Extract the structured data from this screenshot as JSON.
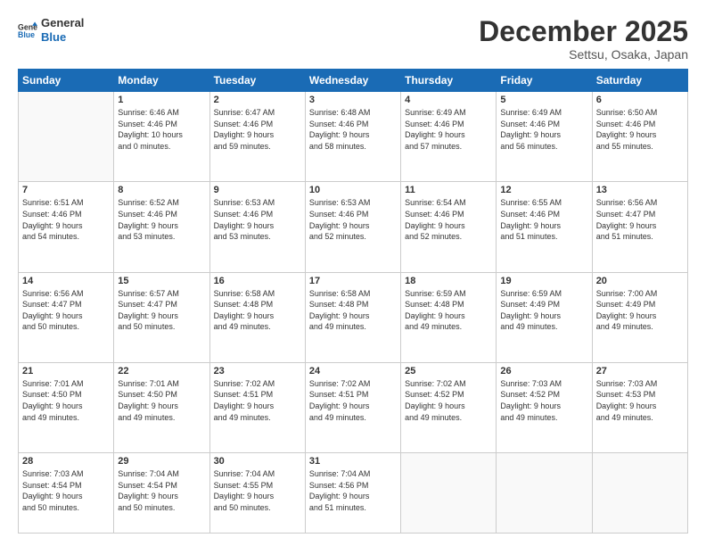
{
  "logo": {
    "line1": "General",
    "line2": "Blue"
  },
  "title": "December 2025",
  "location": "Settsu, Osaka, Japan",
  "days_of_week": [
    "Sunday",
    "Monday",
    "Tuesday",
    "Wednesday",
    "Thursday",
    "Friday",
    "Saturday"
  ],
  "weeks": [
    [
      {
        "day": "",
        "info": ""
      },
      {
        "day": "1",
        "info": "Sunrise: 6:46 AM\nSunset: 4:46 PM\nDaylight: 10 hours\nand 0 minutes."
      },
      {
        "day": "2",
        "info": "Sunrise: 6:47 AM\nSunset: 4:46 PM\nDaylight: 9 hours\nand 59 minutes."
      },
      {
        "day": "3",
        "info": "Sunrise: 6:48 AM\nSunset: 4:46 PM\nDaylight: 9 hours\nand 58 minutes."
      },
      {
        "day": "4",
        "info": "Sunrise: 6:49 AM\nSunset: 4:46 PM\nDaylight: 9 hours\nand 57 minutes."
      },
      {
        "day": "5",
        "info": "Sunrise: 6:49 AM\nSunset: 4:46 PM\nDaylight: 9 hours\nand 56 minutes."
      },
      {
        "day": "6",
        "info": "Sunrise: 6:50 AM\nSunset: 4:46 PM\nDaylight: 9 hours\nand 55 minutes."
      }
    ],
    [
      {
        "day": "7",
        "info": "Sunrise: 6:51 AM\nSunset: 4:46 PM\nDaylight: 9 hours\nand 54 minutes."
      },
      {
        "day": "8",
        "info": "Sunrise: 6:52 AM\nSunset: 4:46 PM\nDaylight: 9 hours\nand 53 minutes."
      },
      {
        "day": "9",
        "info": "Sunrise: 6:53 AM\nSunset: 4:46 PM\nDaylight: 9 hours\nand 53 minutes."
      },
      {
        "day": "10",
        "info": "Sunrise: 6:53 AM\nSunset: 4:46 PM\nDaylight: 9 hours\nand 52 minutes."
      },
      {
        "day": "11",
        "info": "Sunrise: 6:54 AM\nSunset: 4:46 PM\nDaylight: 9 hours\nand 52 minutes."
      },
      {
        "day": "12",
        "info": "Sunrise: 6:55 AM\nSunset: 4:46 PM\nDaylight: 9 hours\nand 51 minutes."
      },
      {
        "day": "13",
        "info": "Sunrise: 6:56 AM\nSunset: 4:47 PM\nDaylight: 9 hours\nand 51 minutes."
      }
    ],
    [
      {
        "day": "14",
        "info": "Sunrise: 6:56 AM\nSunset: 4:47 PM\nDaylight: 9 hours\nand 50 minutes."
      },
      {
        "day": "15",
        "info": "Sunrise: 6:57 AM\nSunset: 4:47 PM\nDaylight: 9 hours\nand 50 minutes."
      },
      {
        "day": "16",
        "info": "Sunrise: 6:58 AM\nSunset: 4:48 PM\nDaylight: 9 hours\nand 49 minutes."
      },
      {
        "day": "17",
        "info": "Sunrise: 6:58 AM\nSunset: 4:48 PM\nDaylight: 9 hours\nand 49 minutes."
      },
      {
        "day": "18",
        "info": "Sunrise: 6:59 AM\nSunset: 4:48 PM\nDaylight: 9 hours\nand 49 minutes."
      },
      {
        "day": "19",
        "info": "Sunrise: 6:59 AM\nSunset: 4:49 PM\nDaylight: 9 hours\nand 49 minutes."
      },
      {
        "day": "20",
        "info": "Sunrise: 7:00 AM\nSunset: 4:49 PM\nDaylight: 9 hours\nand 49 minutes."
      }
    ],
    [
      {
        "day": "21",
        "info": "Sunrise: 7:01 AM\nSunset: 4:50 PM\nDaylight: 9 hours\nand 49 minutes."
      },
      {
        "day": "22",
        "info": "Sunrise: 7:01 AM\nSunset: 4:50 PM\nDaylight: 9 hours\nand 49 minutes."
      },
      {
        "day": "23",
        "info": "Sunrise: 7:02 AM\nSunset: 4:51 PM\nDaylight: 9 hours\nand 49 minutes."
      },
      {
        "day": "24",
        "info": "Sunrise: 7:02 AM\nSunset: 4:51 PM\nDaylight: 9 hours\nand 49 minutes."
      },
      {
        "day": "25",
        "info": "Sunrise: 7:02 AM\nSunset: 4:52 PM\nDaylight: 9 hours\nand 49 minutes."
      },
      {
        "day": "26",
        "info": "Sunrise: 7:03 AM\nSunset: 4:52 PM\nDaylight: 9 hours\nand 49 minutes."
      },
      {
        "day": "27",
        "info": "Sunrise: 7:03 AM\nSunset: 4:53 PM\nDaylight: 9 hours\nand 49 minutes."
      }
    ],
    [
      {
        "day": "28",
        "info": "Sunrise: 7:03 AM\nSunset: 4:54 PM\nDaylight: 9 hours\nand 50 minutes."
      },
      {
        "day": "29",
        "info": "Sunrise: 7:04 AM\nSunset: 4:54 PM\nDaylight: 9 hours\nand 50 minutes."
      },
      {
        "day": "30",
        "info": "Sunrise: 7:04 AM\nSunset: 4:55 PM\nDaylight: 9 hours\nand 50 minutes."
      },
      {
        "day": "31",
        "info": "Sunrise: 7:04 AM\nSunset: 4:56 PM\nDaylight: 9 hours\nand 51 minutes."
      },
      {
        "day": "",
        "info": ""
      },
      {
        "day": "",
        "info": ""
      },
      {
        "day": "",
        "info": ""
      }
    ]
  ]
}
